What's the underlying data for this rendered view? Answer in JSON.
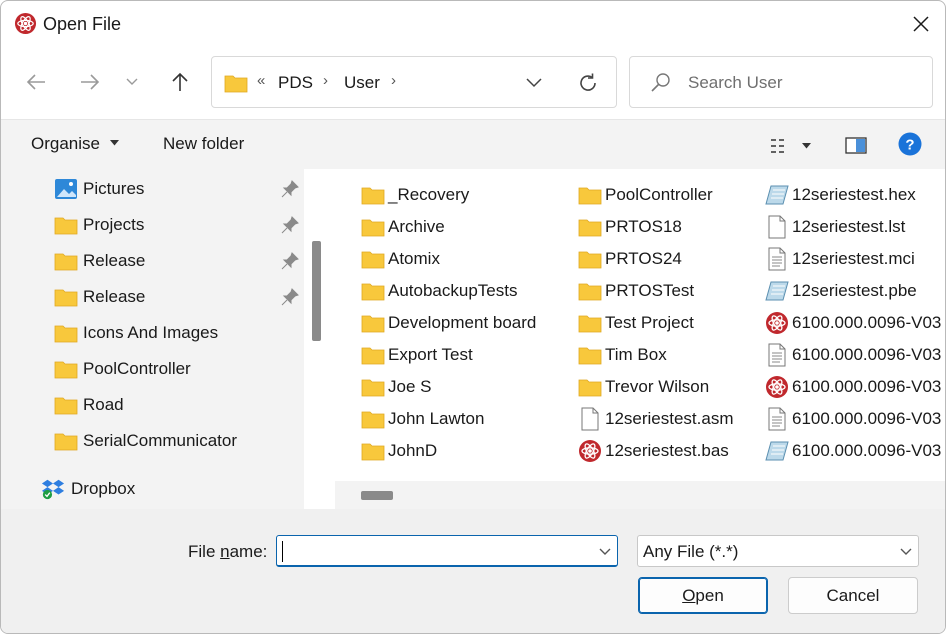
{
  "window": {
    "title": "Open File",
    "close_label": "Close"
  },
  "address": {
    "overflow": "«",
    "crumbs": [
      "PDS",
      "User"
    ]
  },
  "search": {
    "placeholder": "Search User"
  },
  "toolbar": {
    "organise_label": "Organise",
    "new_folder_label": "New folder"
  },
  "sidebar": {
    "items": [
      {
        "label": "Pictures",
        "icon": "pictures-icon",
        "pinned": true
      },
      {
        "label": "Projects",
        "icon": "folder-icon",
        "pinned": true
      },
      {
        "label": "Release",
        "icon": "folder-icon",
        "pinned": true
      },
      {
        "label": "Release",
        "icon": "folder-icon",
        "pinned": true
      },
      {
        "label": "Icons And Images",
        "icon": "folder-icon",
        "pinned": false
      },
      {
        "label": "PoolController",
        "icon": "folder-icon",
        "pinned": false
      },
      {
        "label": "Road",
        "icon": "folder-icon",
        "pinned": false
      },
      {
        "label": "SerialCommunicator",
        "icon": "folder-icon",
        "pinned": false
      },
      {
        "label": "Dropbox",
        "icon": "dropbox-icon",
        "pinned": false
      }
    ]
  },
  "files": {
    "col1": [
      {
        "name": "_Recovery",
        "icon": "folder"
      },
      {
        "name": "Archive",
        "icon": "folder"
      },
      {
        "name": "Atomix",
        "icon": "folder"
      },
      {
        "name": "AutobackupTests",
        "icon": "folder"
      },
      {
        "name": "Development board",
        "icon": "folder"
      },
      {
        "name": "Export Test",
        "icon": "folder"
      },
      {
        "name": "Joe S",
        "icon": "folder"
      },
      {
        "name": "John Lawton",
        "icon": "folder"
      },
      {
        "name": "JohnD",
        "icon": "folder"
      }
    ],
    "col2": [
      {
        "name": "PoolController",
        "icon": "folder"
      },
      {
        "name": "PRTOS18",
        "icon": "folder"
      },
      {
        "name": "PRTOS24",
        "icon": "folder"
      },
      {
        "name": "PRTOSTest",
        "icon": "folder"
      },
      {
        "name": "Test Project",
        "icon": "folder"
      },
      {
        "name": "Tim Box",
        "icon": "folder"
      },
      {
        "name": "Trevor Wilson",
        "icon": "folder"
      },
      {
        "name": "12seriestest.asm",
        "icon": "blank"
      },
      {
        "name": "12seriestest.bas",
        "icon": "atom"
      }
    ],
    "col3": [
      {
        "name": "12seriestest.hex",
        "icon": "hex"
      },
      {
        "name": "12seriestest.lst",
        "icon": "blank"
      },
      {
        "name": "12seriestest.mci",
        "icon": "text"
      },
      {
        "name": "12seriestest.pbe",
        "icon": "hex"
      },
      {
        "name": "6100.000.0096-V03",
        "icon": "atom"
      },
      {
        "name": "6100.000.0096-V03",
        "icon": "text"
      },
      {
        "name": "6100.000.0096-V03",
        "icon": "atom"
      },
      {
        "name": "6100.000.0096-V03",
        "icon": "text"
      },
      {
        "name": "6100.000.0096-V03",
        "icon": "hex"
      }
    ]
  },
  "footer": {
    "file_name_label_pre": "File ",
    "file_name_label_key": "n",
    "file_name_label_post": "ame:",
    "file_name_value": "",
    "file_type_value": "Any File (*.*)",
    "open_key": "O",
    "open_rest": "pen",
    "cancel_label": "Cancel"
  },
  "colors": {
    "folder": "#f8c83c",
    "accent": "#0a64ad",
    "atom": "#c0282d"
  }
}
